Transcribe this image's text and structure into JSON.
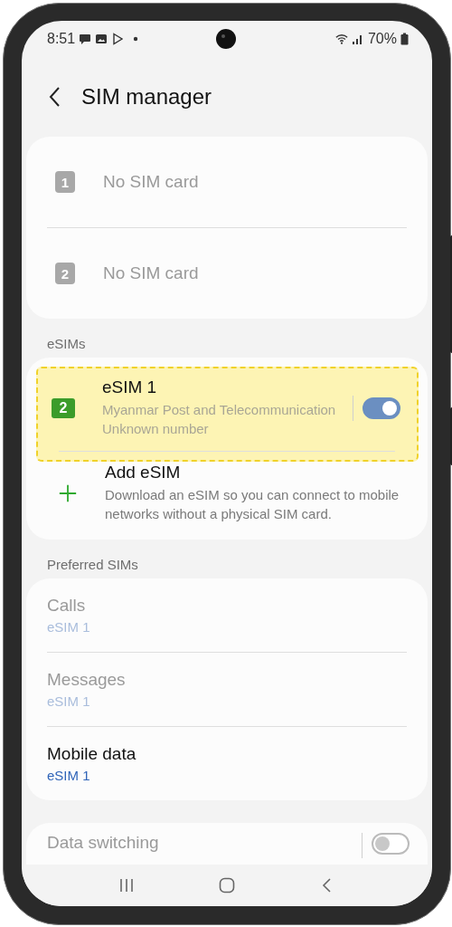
{
  "status_bar": {
    "time": "8:51",
    "battery": "70%"
  },
  "header": {
    "title": "SIM manager"
  },
  "sim_cards": [
    {
      "icon_number": "1",
      "label": "No SIM card",
      "disabled": true
    },
    {
      "icon_number": "2",
      "label": "No SIM card",
      "disabled": true
    }
  ],
  "esims": {
    "heading": "eSIMs",
    "items": [
      {
        "kind": "esim",
        "icon_number": "2",
        "title": "eSIM 1",
        "lines": [
          "Myanmar Post and Telecommunication",
          "Unknown number"
        ],
        "on": true,
        "highlighted": true
      },
      {
        "kind": "add",
        "title": "Add eSIM",
        "lines": [
          "Download an eSIM so you can connect to mobile networks without a physical SIM card."
        ]
      }
    ]
  },
  "preferred_sims": {
    "heading": "Preferred SIMs",
    "items": [
      {
        "label": "Calls",
        "value": "eSIM 1",
        "disabled": true
      },
      {
        "label": "Messages",
        "value": "eSIM 1",
        "disabled": true
      },
      {
        "label": "Mobile data",
        "value": "eSIM 1",
        "disabled": false
      }
    ]
  },
  "data_switching": {
    "label": "Data switching",
    "on": false
  }
}
